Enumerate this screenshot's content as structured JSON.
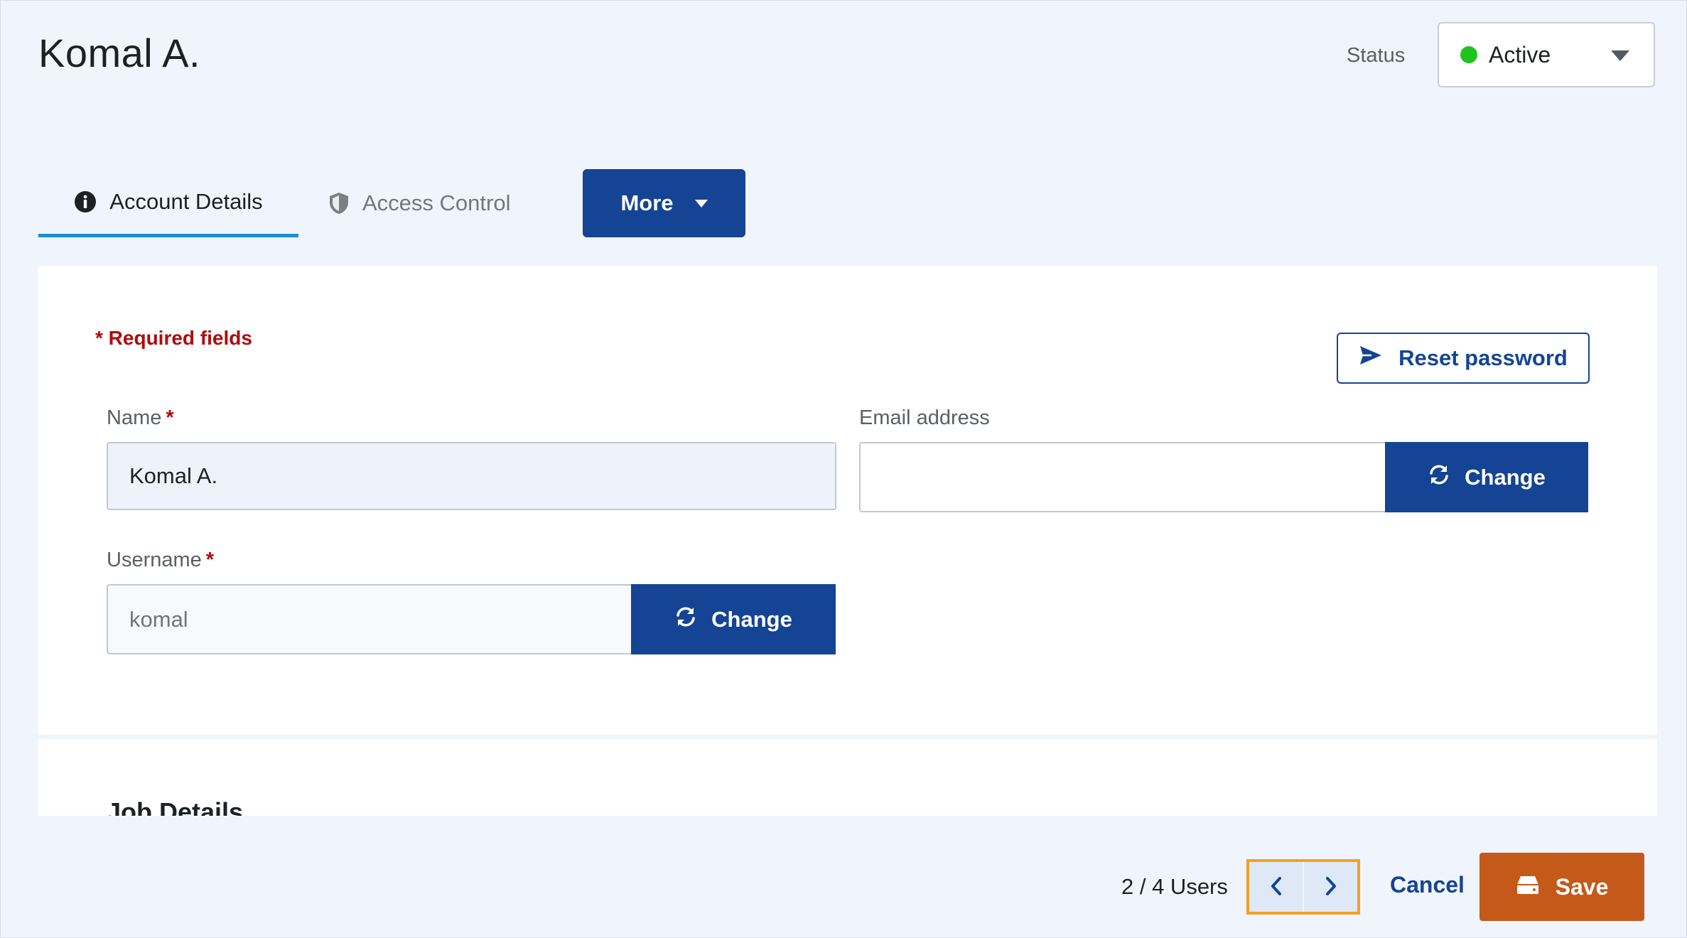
{
  "header": {
    "title": "Komal A.",
    "status_label": "Status",
    "status_value": "Active",
    "status_color": "#1ec31e"
  },
  "tabs": [
    {
      "label": "Account Details",
      "icon": "info-circle-icon",
      "active": true
    },
    {
      "label": "Access Control",
      "icon": "shield-icon",
      "active": false
    }
  ],
  "more_button": {
    "label": "More"
  },
  "form": {
    "required_note": "* Required fields",
    "reset_password_label": "Reset password",
    "name": {
      "label": "Name",
      "required_mark": "*",
      "value": "Komal A."
    },
    "email": {
      "label": "Email address",
      "value": "",
      "change_label": "Change"
    },
    "username": {
      "label": "Username",
      "required_mark": "*",
      "placeholder": "komal",
      "change_label": "Change"
    }
  },
  "job_details": {
    "title": "Job Details"
  },
  "footer": {
    "pager_text": "2 / 4 Users",
    "cancel_label": "Cancel",
    "save_label": "Save",
    "save_color": "#c5591a",
    "primary_color": "#154494"
  }
}
